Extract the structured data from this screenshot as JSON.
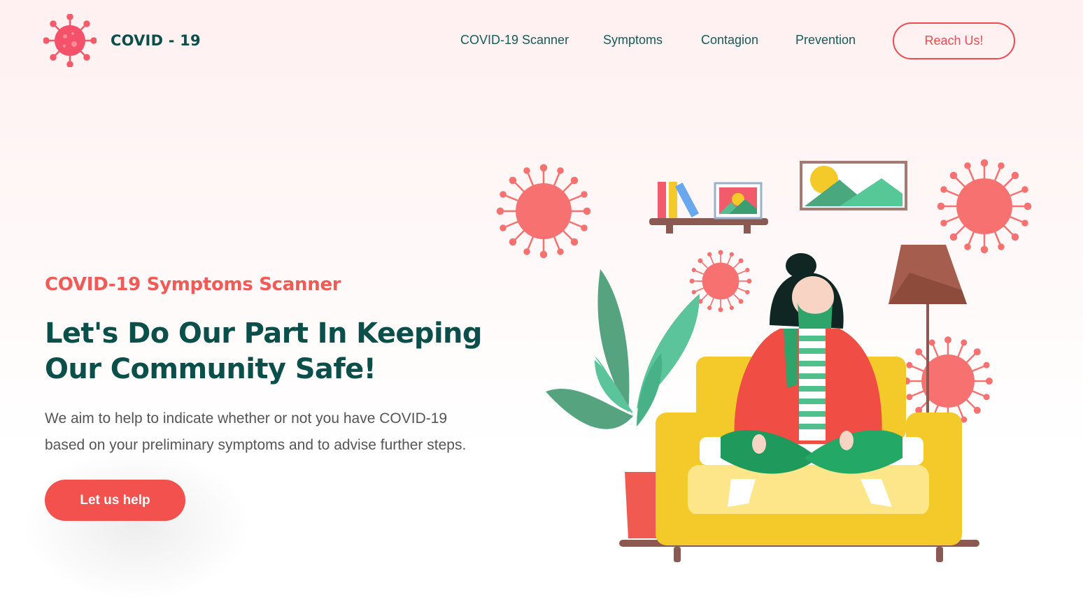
{
  "header": {
    "logo_text": "COVID - 19",
    "logo_icon": "virus-icon",
    "nav": [
      {
        "label": "COVID-19 Scanner"
      },
      {
        "label": "Symptoms"
      },
      {
        "label": "Contagion"
      },
      {
        "label": "Prevention"
      }
    ],
    "cta_label": "Reach Us!"
  },
  "hero": {
    "eyebrow": "COVID-19 Symptoms Scanner",
    "headline_line1": "Let's Do Our Part In Keeping",
    "headline_line2": "Our Community Safe!",
    "description_line1": "We aim to help to indicate whether or not you have COVID-19",
    "description_line2": "based on your preliminary symptoms and to advise further steps.",
    "button_label": "Let us help"
  },
  "colors": {
    "primary": "#f2514d",
    "heading": "#0b4f4a",
    "nav_text": "#185a55",
    "virus": "#f96d6d",
    "sofa": "#f4c92a"
  }
}
